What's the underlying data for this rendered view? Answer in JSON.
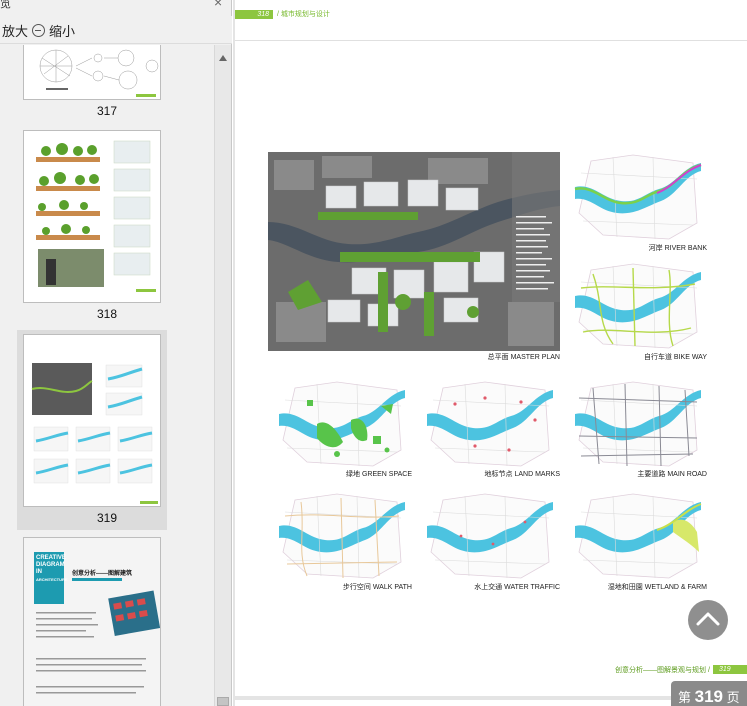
{
  "panel": {
    "title_fragment": "览",
    "close_glyph": "×",
    "zoom_in_label": "放大",
    "zoom_out_label": "缩小",
    "thumbnails": [
      {
        "label": "317"
      },
      {
        "label": "318"
      },
      {
        "label": "319"
      }
    ]
  },
  "thumbnail_text": {
    "book_title_lines": [
      "CREATIVE",
      "DIAGRAM",
      "IN",
      "ARCHITECTURE"
    ],
    "book_cn_title": "创意分析——图解建筑"
  },
  "page": {
    "header_page_num": "318",
    "header_text": "/ 城市规划与设计",
    "footer_text": "创意分析——图解景观与规划 /",
    "footer_page_num": "319",
    "maps": [
      {
        "caption": "总平面 MASTER PLAN"
      },
      {
        "caption": "河岸 RIVER BANK"
      },
      {
        "caption": "自行车道 BIKE WAY"
      },
      {
        "caption": "绿地 GREEN SPACE"
      },
      {
        "caption": "地标节点 LAND MARKS"
      },
      {
        "caption": "主要道路 MAIN ROAD"
      },
      {
        "caption": "步行空间 WALK PATH"
      },
      {
        "caption": "水上交通 WATER TRAFFIC"
      },
      {
        "caption": "湿地和田園 WETLAND & FARM"
      }
    ]
  },
  "page_indicator": {
    "prefix": "第",
    "number": "319",
    "suffix": "页"
  },
  "colors": {
    "accent_green": "#8dc63f",
    "river_blue": "#4cc3e0",
    "panel_bg": "#f0f0f0",
    "viewer_bg": "#e4e4e4"
  }
}
